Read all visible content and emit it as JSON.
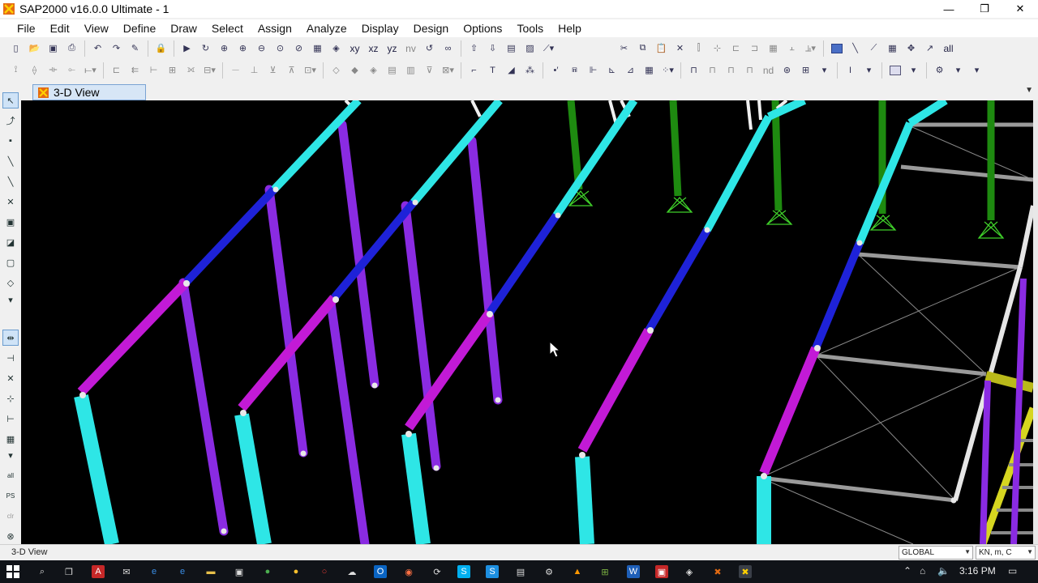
{
  "window": {
    "title": "SAP2000 v16.0.0 Ultimate  - 1",
    "controls": {
      "minimize": "—",
      "maximize": "❐",
      "close": "✕"
    }
  },
  "menu": [
    "File",
    "Edit",
    "View",
    "Define",
    "Draw",
    "Select",
    "Assign",
    "Analyze",
    "Display",
    "Design",
    "Options",
    "Tools",
    "Help"
  ],
  "toolbar": {
    "view_xy": "xy",
    "view_xz": "xz",
    "view_yz": "yz",
    "view_nv": "nv",
    "all_label": "all",
    "nd_label": "nd"
  },
  "left_toolbar": {
    "all_label": "all",
    "ps_label": "PS",
    "clr_label": "clr"
  },
  "tab": {
    "label": "3-D View"
  },
  "status": {
    "view_name": "3-D View",
    "coord_system": "GLOBAL",
    "units": "KN, m, C"
  },
  "taskbar": {
    "time": "3:16 PM"
  },
  "colors": {
    "viewport_bg": "#000000",
    "column": "#2ee6e6",
    "rafter_blue": "#1e22d8",
    "rafter_magenta": "#c21ad6",
    "purple_member": "#8a2be2",
    "green_member": "#1e8a10",
    "grey_member": "#9a9a9a",
    "yellow_member": "#d6d620",
    "tab_bg": "#d7e6f6"
  }
}
